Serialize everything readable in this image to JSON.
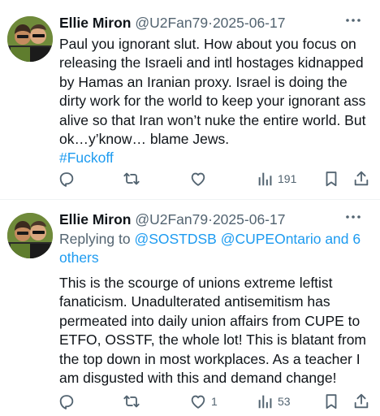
{
  "tweets": [
    {
      "name": "Ellie Miron",
      "handle": "@U2Fan79",
      "separator": "·",
      "date": "2025-06-17",
      "text": "Paul you ignorant slut. How about you focus on releasing the Israeli and intl hostages kidnapped by Hamas an Iranian proxy. Israel is doing the dirty work for the world to keep your ignorant ass alive so that Iran won’t nuke the entire world. But ok…y’know… blame Jews.",
      "hashtag": "#Fuckoff",
      "views": "191",
      "likes": ""
    },
    {
      "name": "Ellie Miron",
      "handle": "@U2Fan79",
      "separator": "·",
      "date": "2025-06-17",
      "replying_prefix": "Replying to",
      "replying_mentions": "@SOSTDSB @CUPEOntario and 6 others",
      "text": "This is the scourge of unions extreme leftist fanaticism. Unadulterated antisemitism has permeated into daily union affairs  from CUPE to ETFO, OSSTF, the whole lot! This is blatant from the top down in most workplaces. As a teacher I am disgusted with this and demand change!",
      "likes": "1",
      "views": "53"
    }
  ],
  "icons": [
    "more-icon",
    "reply-icon",
    "retweet-icon",
    "like-icon",
    "views-icon",
    "bookmark-icon",
    "share-icon"
  ],
  "colors": {
    "text": "#0f1419",
    "secondary": "#536471",
    "link": "#1d9bf0",
    "divider": "#eff3f4"
  }
}
